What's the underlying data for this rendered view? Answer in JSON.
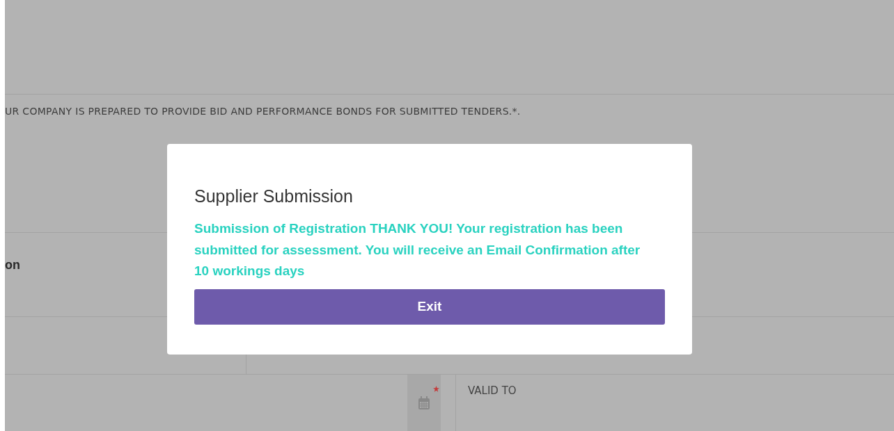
{
  "form": {
    "declaration": "UR COMPANY IS PREPARED TO PROVIDE BID AND PERFORMANCE BONDS FOR SUBMITTED TENDERS.*.",
    "section_label": "on",
    "date_field": {
      "required": true
    },
    "valid_to_label": "VALID TO"
  },
  "dialog": {
    "title": "Supplier Submission",
    "message": "Submission of Registration THANK YOU! Your registration has been submitted for assessment. You will receive an Email Confirmation after 10 workings days",
    "button": "Exit"
  }
}
